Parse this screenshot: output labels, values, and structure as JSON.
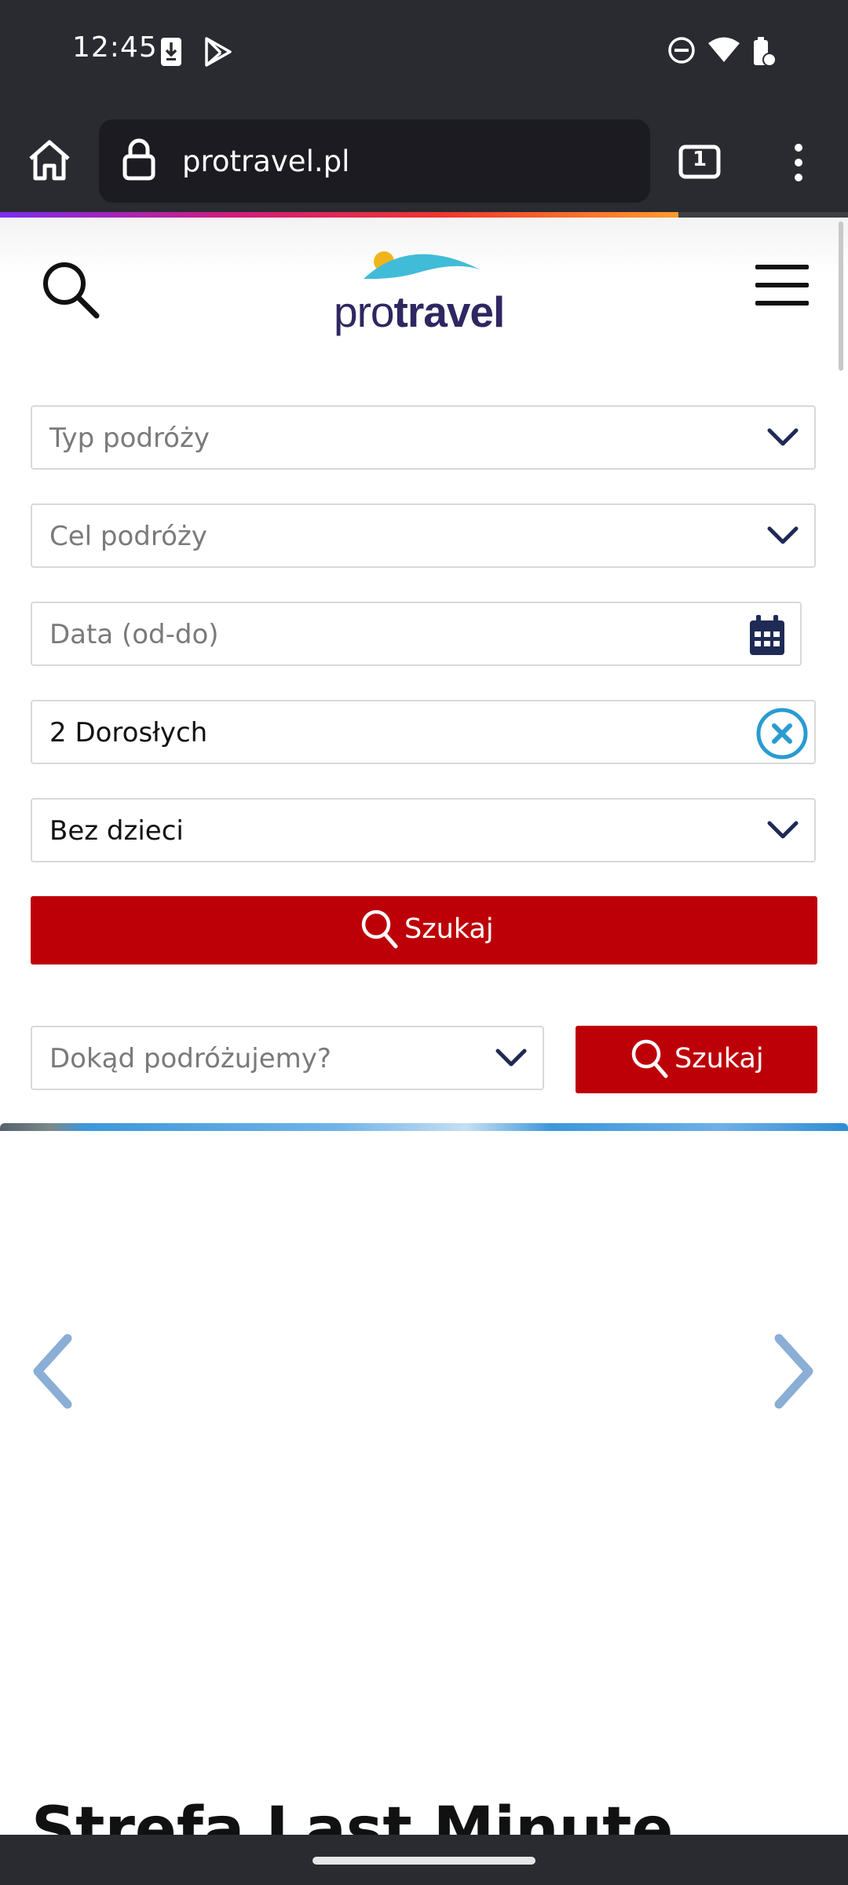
{
  "status_bar": {
    "time": "12:45",
    "left_icons": [
      "download-icon",
      "play-store-icon"
    ],
    "right_icons": [
      "dnd-icon",
      "wifi-icon",
      "battery-icon"
    ]
  },
  "browser": {
    "url": "protravel.pl",
    "tab_count": "1",
    "page_load_progress": 0.8,
    "colors": {
      "chrome": "#2a2a31",
      "url_box": "#1c1b21"
    }
  },
  "header": {
    "logo_pro": "pro",
    "logo_travel": "travel",
    "icons": [
      "search-icon",
      "hamburger-menu-icon"
    ]
  },
  "search_form": {
    "trip_type_placeholder": "Typ podróży",
    "destination_placeholder": "Cel podróży",
    "date_placeholder": "Data (od-do)",
    "adults_value": "2 Dorosłych",
    "children_value": "Bez dzieci",
    "submit_label": "Szukaj"
  },
  "quick_search": {
    "placeholder": "Dokąd podróżujemy?",
    "submit_label": "Szukaj"
  },
  "section": {
    "title": "Strefa Last Minute"
  },
  "colors": {
    "accent_red": "#bd0008",
    "navy": "#1f2a55",
    "cyan": "#2a9bd1",
    "arrow": "#8aaed6"
  }
}
